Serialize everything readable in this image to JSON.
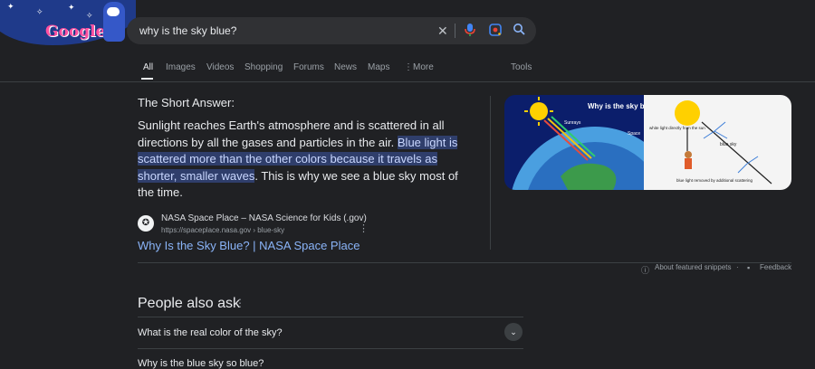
{
  "doodle": {
    "word": "Google"
  },
  "search": {
    "query": "why is the sky blue?",
    "icons": [
      "close-icon",
      "microphone-icon",
      "lens-icon",
      "search-icon"
    ]
  },
  "tabs": {
    "items": [
      "All",
      "Images",
      "Videos",
      "Shopping",
      "Forums",
      "News",
      "Maps",
      "More"
    ],
    "tools": "Tools"
  },
  "snippet": {
    "heading": "The Short Answer:",
    "text_before": "Sunlight reaches Earth's atmosphere and is scattered in all directions by all the gases and particles in the air. ",
    "text_highlight": "Blue light is scattered more than the other colors because it travels as shorter, smaller waves",
    "text_after": ". This is why we see a blue sky most of the time.",
    "source_name": "NASA Space Place – NASA Science for Kids (.gov)",
    "source_url": "https://spaceplace.nasa.gov › blue-sky",
    "link_title": "Why Is the Sky Blue? | NASA Space Place"
  },
  "image": {
    "left_title": "Why is the sky blu",
    "left_labels": [
      "Sunrays",
      "Space"
    ],
    "right_labels": [
      "white light directly from the sun",
      "blue sky",
      "blue light removed by additional scattering"
    ]
  },
  "featured": {
    "about": "About featured snippets",
    "feedback": "Feedback"
  },
  "paa": {
    "title": "People also ask",
    "questions": [
      "What is the real color of the sky?",
      "Why is the blue sky so blue?"
    ]
  },
  "colors": {
    "background": "#202124",
    "link": "#8ab4f8",
    "highlight": "#2f3e6b"
  }
}
